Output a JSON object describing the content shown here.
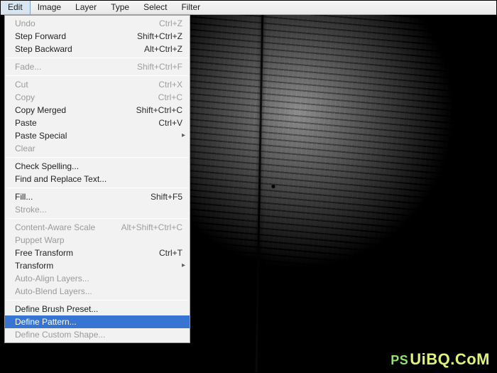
{
  "menubar": {
    "items": [
      {
        "label": "Edit",
        "active": true
      },
      {
        "label": "Image"
      },
      {
        "label": "Layer"
      },
      {
        "label": "Type"
      },
      {
        "label": "Select"
      },
      {
        "label": "Filter"
      }
    ]
  },
  "dropdown": {
    "groups": [
      [
        {
          "label": "Undo",
          "shortcut": "Ctrl+Z",
          "disabled": true
        },
        {
          "label": "Step Forward",
          "shortcut": "Shift+Ctrl+Z"
        },
        {
          "label": "Step Backward",
          "shortcut": "Alt+Ctrl+Z"
        }
      ],
      [
        {
          "label": "Fade...",
          "shortcut": "Shift+Ctrl+F",
          "disabled": true
        }
      ],
      [
        {
          "label": "Cut",
          "shortcut": "Ctrl+X",
          "disabled": true
        },
        {
          "label": "Copy",
          "shortcut": "Ctrl+C",
          "disabled": true
        },
        {
          "label": "Copy Merged",
          "shortcut": "Shift+Ctrl+C"
        },
        {
          "label": "Paste",
          "shortcut": "Ctrl+V"
        },
        {
          "label": "Paste Special",
          "submenu": true
        },
        {
          "label": "Clear",
          "disabled": true
        }
      ],
      [
        {
          "label": "Check Spelling..."
        },
        {
          "label": "Find and Replace Text..."
        }
      ],
      [
        {
          "label": "Fill...",
          "shortcut": "Shift+F5"
        },
        {
          "label": "Stroke...",
          "disabled": true
        }
      ],
      [
        {
          "label": "Content-Aware Scale",
          "shortcut": "Alt+Shift+Ctrl+C",
          "disabled": true
        },
        {
          "label": "Puppet Warp",
          "disabled": true
        },
        {
          "label": "Free Transform",
          "shortcut": "Ctrl+T"
        },
        {
          "label": "Transform",
          "submenu": true
        },
        {
          "label": "Auto-Align Layers...",
          "disabled": true
        },
        {
          "label": "Auto-Blend Layers...",
          "disabled": true
        }
      ],
      [
        {
          "label": "Define Brush Preset..."
        },
        {
          "label": "Define Pattern...",
          "highlight": true
        },
        {
          "label": "Define Custom Shape...",
          "disabled": true
        }
      ]
    ]
  },
  "watermark": {
    "prefix": "PS",
    "text": "UiBQ.CoM"
  }
}
